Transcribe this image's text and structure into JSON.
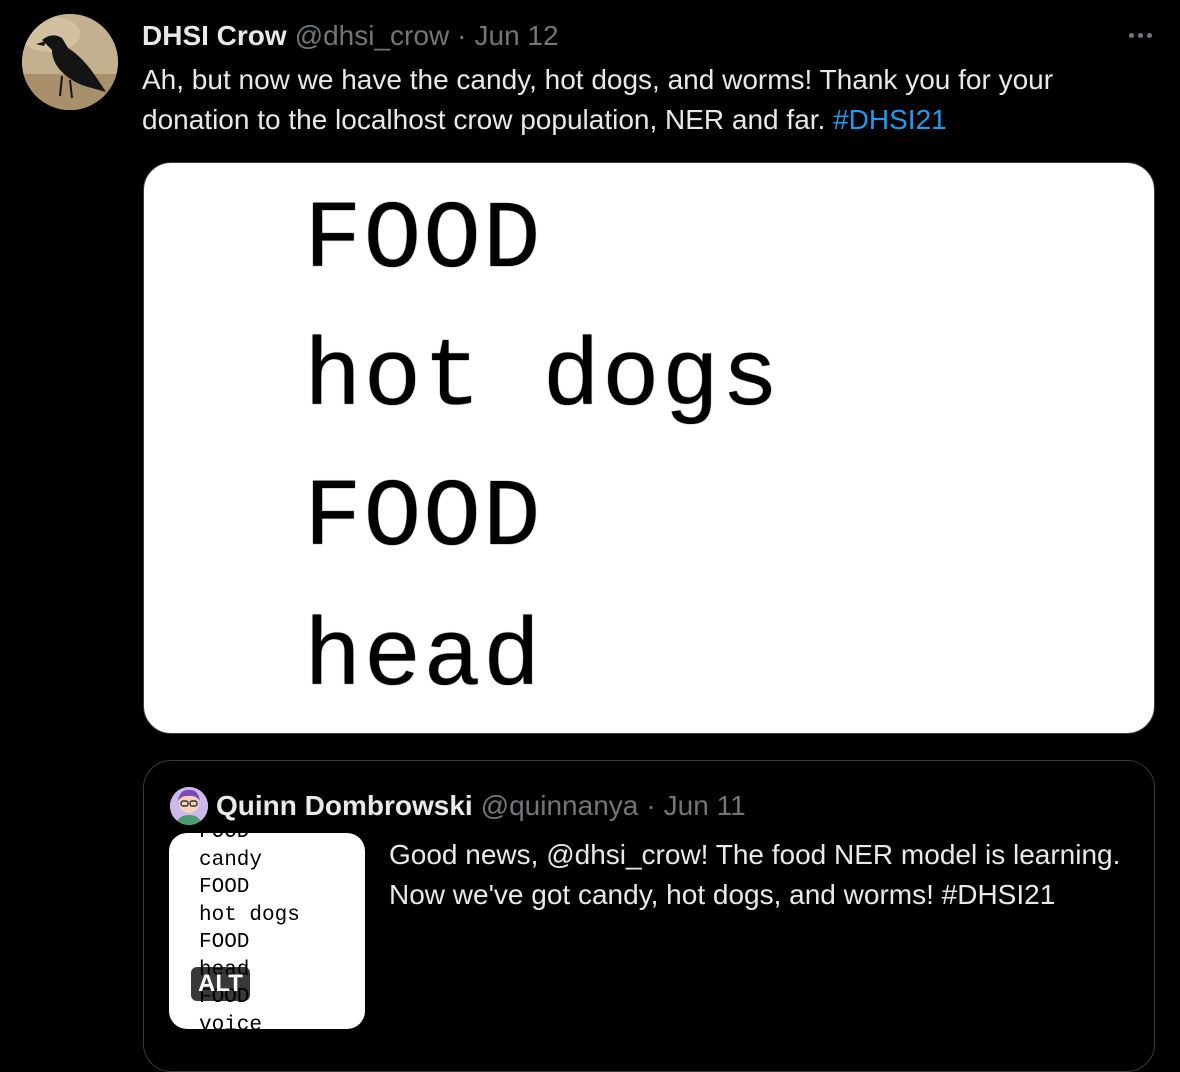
{
  "tweet": {
    "author_name": "DHSI Crow",
    "handle": "@dhsi_crow",
    "separator": "·",
    "date": "Jun 12",
    "more_icon": "more-horizontal-icon",
    "text_main": "Ah, but now we have the candy, hot dogs, and worms! Thank you for your donation to the localhost crow population, NER and far. ",
    "hashtag": "#DHSI21",
    "hashtag_color": "#1d9bf0",
    "media_lines": [
      "FOOD",
      "hot dogs",
      "FOOD",
      "head"
    ]
  },
  "quoted": {
    "author_name": "Quinn Dombrowski",
    "handle": "@quinnanya",
    "separator": "·",
    "date": "Jun 11",
    "thumb_lines": [
      "FOOD",
      "candy",
      "FOOD",
      "hot dogs",
      "FOOD",
      "head",
      "FOOD",
      "voice"
    ],
    "alt_label": "ALT",
    "text": "Good news, @dhsi_crow! The food NER model is learning. Now we've got candy, hot dogs, and worms! #DHSI21"
  }
}
